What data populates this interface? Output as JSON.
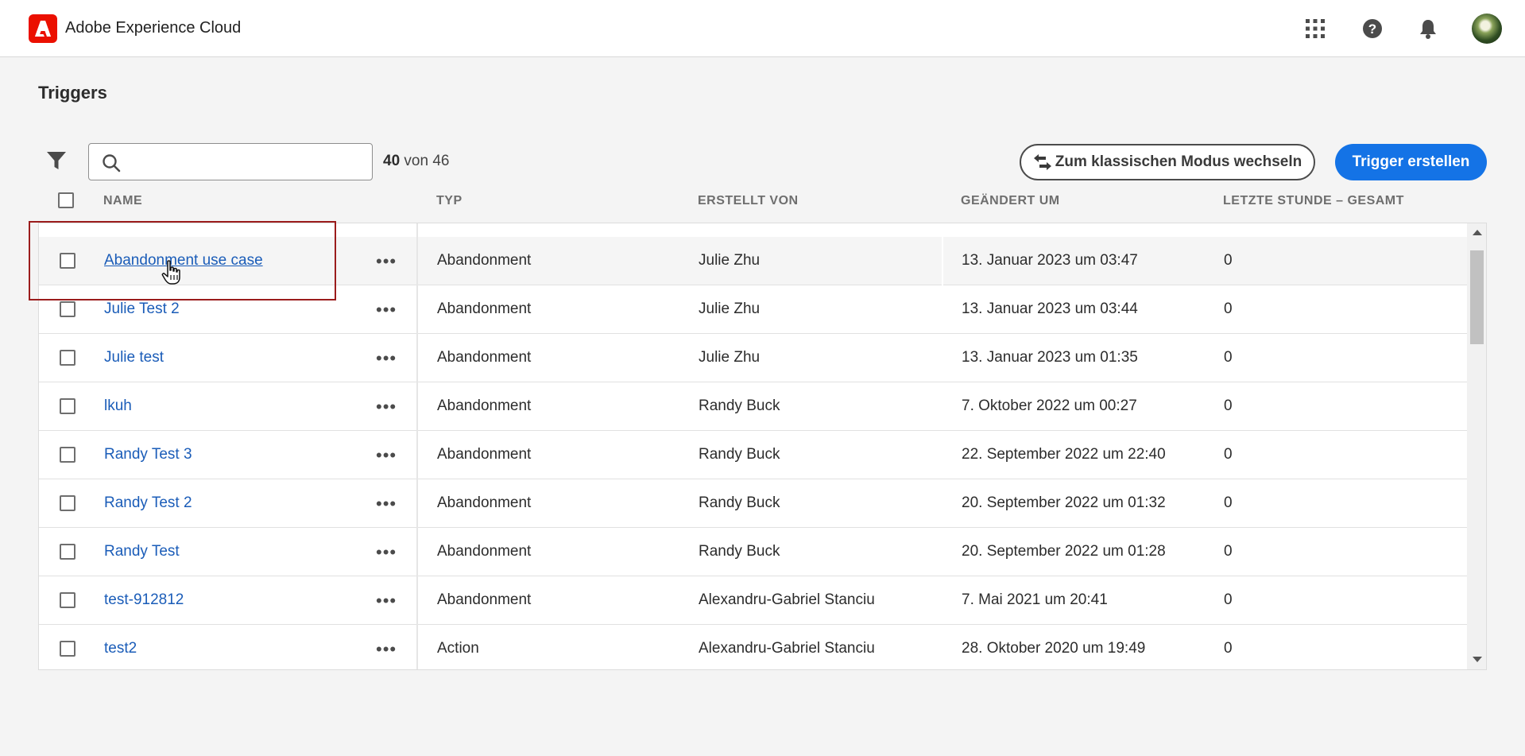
{
  "app": {
    "title": "Adobe Experience Cloud",
    "logo_icon": "adobe-logo-icon",
    "brand_color": "#eb1000",
    "accent_color": "#1473e6"
  },
  "topbar": {
    "icons": [
      "apps-grid-icon",
      "help-icon",
      "notification-bell-icon",
      "user-avatar"
    ]
  },
  "page": {
    "title": "Triggers"
  },
  "toolbar": {
    "search_value": "",
    "search_placeholder": "",
    "count_shown": "40",
    "count_label": "von 46",
    "switch_classic_label": "Zum klassischen Modus wechseln",
    "create_label": "Trigger erstellen"
  },
  "table": {
    "columns": [
      "NAME",
      "TYP",
      "ERSTELLT VON",
      "GEÄNDERT UM",
      "LETZTE STUNDE – GESAMT"
    ],
    "rows": [
      {
        "name": "Abandonment use case",
        "type": "Abandonment",
        "created_by": "Julie Zhu",
        "modified": "13. Januar 2023 um 03:47",
        "last_hour": "0"
      },
      {
        "name": "Julie Test 2",
        "type": "Abandonment",
        "created_by": "Julie Zhu",
        "modified": "13. Januar 2023 um 03:44",
        "last_hour": "0"
      },
      {
        "name": "Julie test",
        "type": "Abandonment",
        "created_by": "Julie Zhu",
        "modified": "13. Januar 2023 um 01:35",
        "last_hour": "0"
      },
      {
        "name": "lkuh",
        "type": "Abandonment",
        "created_by": "Randy Buck",
        "modified": "7. Oktober 2022 um 00:27",
        "last_hour": "0"
      },
      {
        "name": "Randy Test 3",
        "type": "Abandonment",
        "created_by": "Randy Buck",
        "modified": "22. September 2022 um 22:40",
        "last_hour": "0"
      },
      {
        "name": "Randy Test 2",
        "type": "Abandonment",
        "created_by": "Randy Buck",
        "modified": "20. September 2022 um 01:32",
        "last_hour": "0"
      },
      {
        "name": "Randy Test",
        "type": "Abandonment",
        "created_by": "Randy Buck",
        "modified": "20. September 2022 um 01:28",
        "last_hour": "0"
      },
      {
        "name": "test-912812",
        "type": "Abandonment",
        "created_by": "Alexandru-Gabriel Stanciu",
        "modified": "7. Mai 2021 um 20:41",
        "last_hour": "0"
      },
      {
        "name": "test2",
        "type": "Action",
        "created_by": "Alexandru-Gabriel Stanciu",
        "modified": "28. Oktober 2020 um 19:49",
        "last_hour": "0"
      }
    ]
  }
}
